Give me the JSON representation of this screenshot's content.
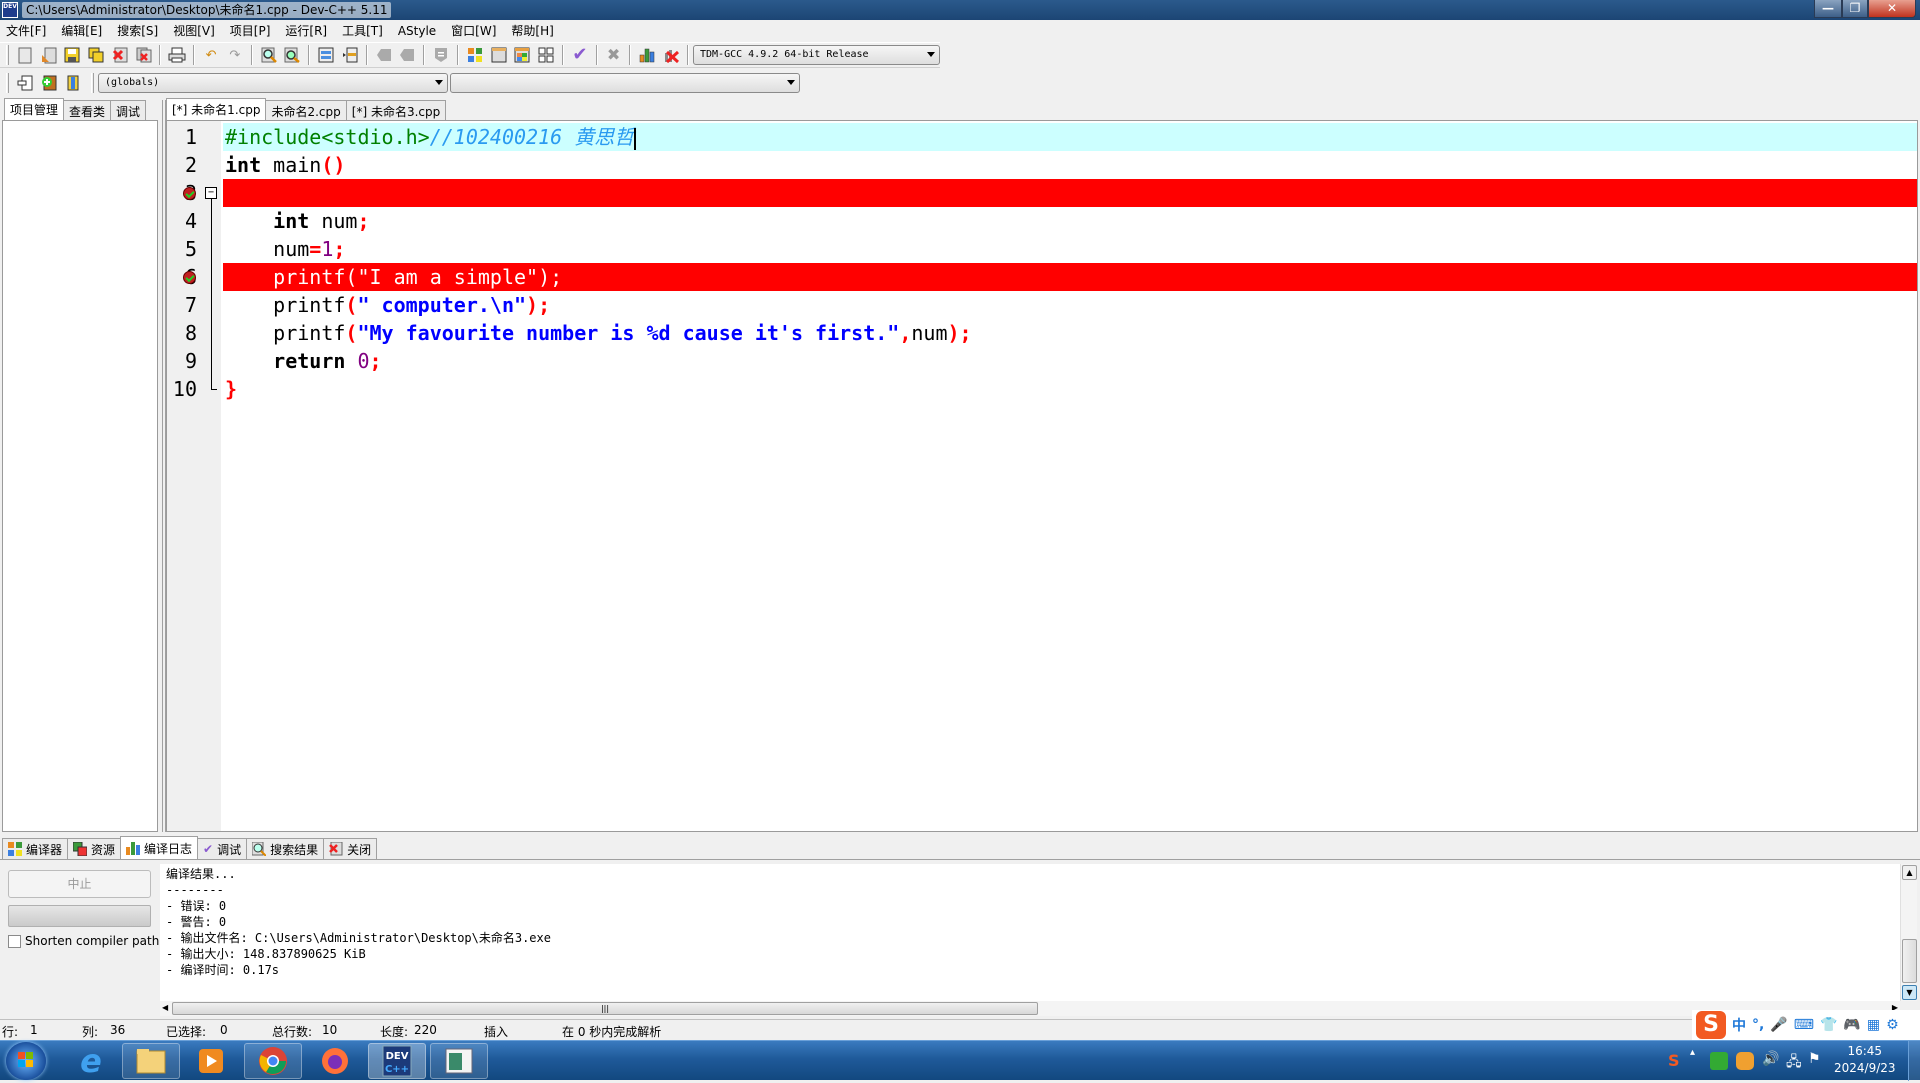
{
  "window": {
    "title": "C:\\Users\\Administrator\\Desktop\\未命名1.cpp - Dev-C++ 5.11",
    "app_icon_text": "DEV",
    "controls": {
      "minimize": "—",
      "maximize": "❐",
      "close": "✕"
    }
  },
  "menu": [
    "文件[F]",
    "编辑[E]",
    "搜索[S]",
    "视图[V]",
    "项目[P]",
    "运行[R]",
    "工具[T]",
    "AStyle",
    "窗口[W]",
    "帮助[H]"
  ],
  "toolbar": {
    "icons": [
      "new-file-icon",
      "open-file-icon",
      "save-icon",
      "save-all-icon",
      "close-file-icon",
      "close-all-icon",
      "print-icon",
      "undo-icon",
      "redo-icon",
      "find-icon",
      "replace-icon",
      "indent-icon",
      "unindent-icon",
      "bookmark-prev-icon",
      "bookmark-next-icon",
      "goto-icon",
      "compile-icon",
      "run-icon",
      "compile-run-icon",
      "rebuild-icon",
      "syntax-check-icon",
      "stop-icon",
      "profile-icon",
      "delete-profile-icon"
    ],
    "compiler_select": "TDM-GCC 4.9.2 64-bit Release",
    "globals_select": "(globals)",
    "members_select": ""
  },
  "left_panel": {
    "tabs": [
      "项目管理",
      "查看类",
      "调试"
    ],
    "active_tab": 0
  },
  "editor": {
    "tabs": [
      "[*] 未命名1.cpp",
      "未命名2.cpp",
      "[*] 未命名3.cpp"
    ],
    "active_tab": 0,
    "lines": [
      {
        "n": "1",
        "tokens": [
          {
            "t": "#include<stdio.h>",
            "c": "pre"
          },
          {
            "t": "//102400216 黄思哲",
            "c": "cm"
          }
        ],
        "highlight": "current",
        "caret": true
      },
      {
        "n": "2",
        "tokens": [
          {
            "t": "int",
            "c": "kw"
          },
          {
            "t": " main",
            "c": "id"
          },
          {
            "t": "()",
            "c": "sym"
          }
        ]
      },
      {
        "n": "3",
        "tokens": [
          {
            "t": "{",
            "c": "sym"
          }
        ],
        "highlight": "breakpoint",
        "breakpoint": true,
        "fold": true
      },
      {
        "n": "4",
        "tokens": [
          {
            "t": "    ",
            "c": "id"
          },
          {
            "t": "int",
            "c": "kw"
          },
          {
            "t": " num",
            "c": "id"
          },
          {
            "t": ";",
            "c": "sym"
          }
        ]
      },
      {
        "n": "5",
        "tokens": [
          {
            "t": "    num",
            "c": "id"
          },
          {
            "t": "=",
            "c": "sym"
          },
          {
            "t": "1",
            "c": "num"
          },
          {
            "t": ";",
            "c": "sym"
          }
        ]
      },
      {
        "n": "6",
        "tokens": [
          {
            "t": "    printf(\"I am a simple\");",
            "c": "bpline"
          }
        ],
        "highlight": "breakpoint",
        "breakpoint": true
      },
      {
        "n": "7",
        "tokens": [
          {
            "t": "    printf",
            "c": "id"
          },
          {
            "t": "(",
            "c": "sym"
          },
          {
            "t": "\" computer.\\n\"",
            "c": "str"
          },
          {
            "t": ");",
            "c": "sym"
          }
        ]
      },
      {
        "n": "8",
        "tokens": [
          {
            "t": "    printf",
            "c": "id"
          },
          {
            "t": "(",
            "c": "sym"
          },
          {
            "t": "\"My favourite number is %d cause it's first.\"",
            "c": "str"
          },
          {
            "t": ",",
            "c": "sym"
          },
          {
            "t": "num",
            "c": "id"
          },
          {
            "t": ");",
            "c": "sym"
          }
        ]
      },
      {
        "n": "9",
        "tokens": [
          {
            "t": "    ",
            "c": "id"
          },
          {
            "t": "return",
            "c": "kw"
          },
          {
            "t": " ",
            "c": "id"
          },
          {
            "t": "0",
            "c": "num"
          },
          {
            "t": ";",
            "c": "sym"
          }
        ]
      },
      {
        "n": "10",
        "tokens": [
          {
            "t": "}",
            "c": "sym"
          }
        ],
        "fold_end": true
      }
    ]
  },
  "bottom_panel": {
    "tabs": [
      {
        "label": "编译器",
        "icon": "compiler-icon"
      },
      {
        "label": "资源",
        "icon": "resources-icon"
      },
      {
        "label": "编译日志",
        "icon": "compile-log-icon"
      },
      {
        "label": "调试",
        "icon": "debug-icon"
      },
      {
        "label": "搜索结果",
        "icon": "search-results-icon"
      },
      {
        "label": "关闭",
        "icon": "close-icon"
      }
    ],
    "active_tab": 2,
    "abort_label": "中止",
    "shorten_paths_label": "Shorten compiler paths",
    "shorten_paths_checked": false,
    "log": [
      "编译结果...",
      "--------",
      "- 错误: 0",
      "- 警告: 0",
      "- 输出文件名: C:\\Users\\Administrator\\Desktop\\未命名3.exe",
      "- 输出大小: 148.837890625 KiB",
      "- 编译时间: 0.17s"
    ]
  },
  "status_bar": {
    "row_label": "行:",
    "row": "1",
    "col_label": "列:",
    "col": "36",
    "sel_label": "已选择:",
    "sel": "0",
    "lines_label": "总行数:",
    "lines": "10",
    "len_label": "长度:",
    "len": "220",
    "mode": "插入",
    "parse": "在 0 秒内完成解析"
  },
  "ime": {
    "logo": "S",
    "items": [
      "中",
      "°,",
      "🎤",
      "⌨",
      "👕",
      "🎮",
      "▦",
      "⚙"
    ]
  },
  "taskbar": {
    "apps": [
      "internet-explorer",
      "file-explorer",
      "media-player",
      "chrome",
      "firefox",
      "dev-cpp",
      "window-app"
    ],
    "clock_time": "16:45",
    "clock_date": "2024/9/23"
  },
  "colors": {
    "breakpoint_line": "#ff0000",
    "current_line": "#ccffff",
    "preprocessor": "#008000",
    "comment": "#2a9af0",
    "string": "#0000ff",
    "symbol": "#ff0000",
    "number": "#800080"
  }
}
